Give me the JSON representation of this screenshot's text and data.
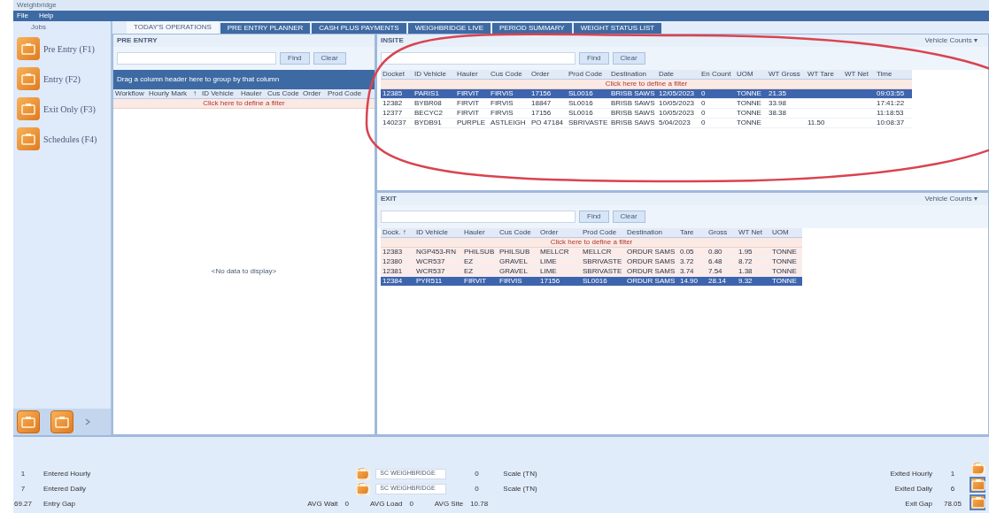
{
  "window": {
    "title": "Weighbridge"
  },
  "menu": [
    "File",
    "Help"
  ],
  "sidebar": {
    "title": "Jobs",
    "items": [
      {
        "label": "Pre Entry (F1)"
      },
      {
        "label": "Entry (F2)"
      },
      {
        "label": "Exit Only (F3)"
      },
      {
        "label": "Schedules (F4)"
      }
    ]
  },
  "tabs": [
    {
      "label": "TODAY'S OPERATIONS",
      "selected": true
    },
    {
      "label": "PRE ENTRY PLANNER",
      "selected": false
    },
    {
      "label": "CASH PLUS PAYMENTS",
      "selected": false
    },
    {
      "label": "WEIGHBRIDGE LIVE",
      "selected": false
    },
    {
      "label": "PERIOD SUMMARY",
      "selected": false
    },
    {
      "label": "WEIGHT STATUS LIST",
      "selected": false
    }
  ],
  "pre_entry": {
    "title": "PRE ENTRY",
    "buttons": [
      "Find",
      "Clear"
    ],
    "group_hint": "Drag a column header here to group by that column",
    "columns": [
      "Workflow",
      "Hourly Mark",
      "↑",
      "ID Vehicle",
      "Hauler",
      "Cus Code",
      "Order",
      "Prod Code"
    ],
    "filter_hint": "Click here to define a filter",
    "empty": "<No data to display>"
  },
  "insite": {
    "title": "INSITE",
    "counts": "Vehicle Counts ▾",
    "buttons": [
      "Find",
      "Clear"
    ],
    "columns": [
      "Docket",
      "ID Vehicle",
      "Hauler",
      "Cus Code",
      "Order",
      "Prod Code",
      "Destination",
      "Date",
      "En Count",
      "UOM",
      "WT Gross",
      "WT Tare",
      "WT Net",
      "Time"
    ],
    "filter_hint": "Click here to define a filter",
    "rows": [
      {
        "selected": true,
        "cells": [
          "12385",
          "PARIS1",
          "FIRVIT",
          "FIRVIS",
          "17156",
          "SL0016",
          "BRISB SAWS",
          "12/05/2023",
          "0",
          "TONNE",
          "21.35",
          "",
          "",
          "09:03:55"
        ]
      },
      {
        "selected": false,
        "cells": [
          "12382",
          "BYBR08",
          "FIRVIT",
          "FIRVIS",
          "18847",
          "SL0016",
          "BRISB SAWS",
          "10/05/2023",
          "0",
          "TONNE",
          "33.98",
          "",
          "",
          "17:41:22"
        ]
      },
      {
        "selected": false,
        "cells": [
          "12377",
          "BECYC2",
          "FIRVIT",
          "FIRVIS",
          "17156",
          "SL0016",
          "BRISB SAWS",
          "10/05/2023",
          "0",
          "TONNE",
          "38.38",
          "",
          "",
          "11:18:53"
        ]
      },
      {
        "selected": false,
        "cells": [
          "140237",
          "BYDB91",
          "PURPLE",
          "ASTLEIGH",
          "PO 47184",
          "SBRIVASTE",
          "BRISB SAWS",
          "5/04/2023",
          "0",
          "TONNE",
          "",
          "11.50",
          "",
          "10:08:37"
        ]
      }
    ]
  },
  "exit": {
    "title": "EXIT",
    "counts": "Vehicle Counts ▾",
    "buttons": [
      "Find",
      "Clear"
    ],
    "columns": [
      "Dock. ↑",
      "ID Vehicle",
      "Hauler",
      "Cus Code",
      "Order",
      "Prod Code",
      "Destination",
      "Tare",
      "Gross",
      "WT Net",
      "UOM"
    ],
    "filter_hint": "Click here to define a filter",
    "rows": [
      {
        "selected": false,
        "cells": [
          "12383",
          "NGP453-RN",
          "PHILSUB",
          "PHILSUB",
          "MELLCR",
          "MELLCR",
          "ORDUR SAMS",
          "0.05",
          "0.80",
          "1.95",
          "TONNE"
        ]
      },
      {
        "selected": false,
        "cells": [
          "12380",
          "WCR537",
          "EZ",
          "GRAVEL",
          "LIME",
          "SBRIVASTE",
          "ORDUR SAMS",
          "3.72",
          "6.48",
          "8.72",
          "TONNE"
        ]
      },
      {
        "selected": false,
        "cells": [
          "12381",
          "WCR537",
          "EZ",
          "GRAVEL",
          "LIME",
          "SBRIVASTE",
          "ORDUR SAMS",
          "3.74",
          "7.54",
          "1.38",
          "TONNE"
        ]
      },
      {
        "selected": true,
        "cells": [
          "12384",
          "PYR511",
          "FIRVIT",
          "FIRVIS",
          "17156",
          "SL0016",
          "ORDUR SAMS",
          "14.90",
          "28.14",
          "9.32",
          "TONNE"
        ]
      }
    ]
  },
  "status": {
    "left": [
      {
        "value": "1",
        "label": "Entered Hourly"
      },
      {
        "value": "7",
        "label": "Entered Daily"
      },
      {
        "value": "69.27",
        "label": "Entry Gap"
      }
    ],
    "scales": [
      {
        "device": "SC WEIGHBRIDGE",
        "value": "0",
        "label": "Scale (TN)"
      },
      {
        "device": "SC WEIGHBRIDGE",
        "value": "0",
        "label": "Scale (TN)"
      }
    ],
    "averages": [
      {
        "label": "AVG Wait",
        "value": "0"
      },
      {
        "label": "AVG Load",
        "value": "0"
      },
      {
        "label": "AVG Site",
        "value": "10.78"
      }
    ],
    "right": [
      {
        "label": "Exited Hourly",
        "value": "1"
      },
      {
        "label": "Exited Daily",
        "value": "6"
      },
      {
        "label": "Exit Gap",
        "value": "78.05"
      }
    ]
  }
}
